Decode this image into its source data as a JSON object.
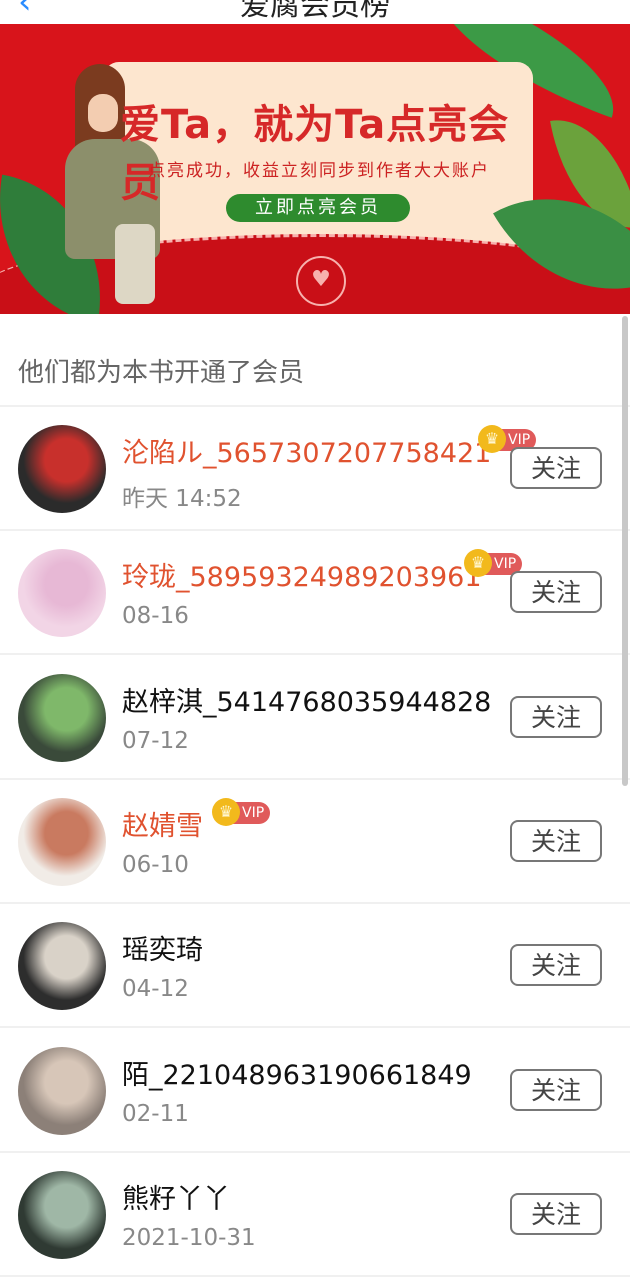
{
  "header": {
    "title": "爱腐会员榜",
    "back_icon": "back-arrow-icon"
  },
  "banner": {
    "headline": "爱Ta，就为Ta点亮会员",
    "subline": "点亮成功，收益立刻同步到作者大大账户",
    "cta_label": "立即点亮会员",
    "seal_icon": "heart-seal-icon",
    "colors": {
      "background": "#d8141b",
      "card": "#fde6cf",
      "cta": "#2e8b2e"
    }
  },
  "section": {
    "title": "他们都为本书开通了会员"
  },
  "badge": {
    "vip_label": "VIP"
  },
  "members": [
    {
      "name": "沦陷ル_5657307207758421",
      "date": "昨天 14:52",
      "vip": true,
      "follow_label": "关注"
    },
    {
      "name": "玲珑_58959324989203961",
      "date": "08-16",
      "vip": true,
      "follow_label": "关注"
    },
    {
      "name": "赵梓淇_5414768035944828",
      "date": "07-12",
      "vip": false,
      "follow_label": "关注"
    },
    {
      "name": "赵婧雪",
      "date": "06-10",
      "vip": true,
      "follow_label": "关注"
    },
    {
      "name": "瑶奕琦",
      "date": "04-12",
      "vip": false,
      "follow_label": "关注"
    },
    {
      "name": "陌_221048963190661849",
      "date": "02-11",
      "vip": false,
      "follow_label": "关注"
    },
    {
      "name": "熊籽丫丫",
      "date": "2021-10-31",
      "vip": false,
      "follow_label": "关注"
    }
  ]
}
